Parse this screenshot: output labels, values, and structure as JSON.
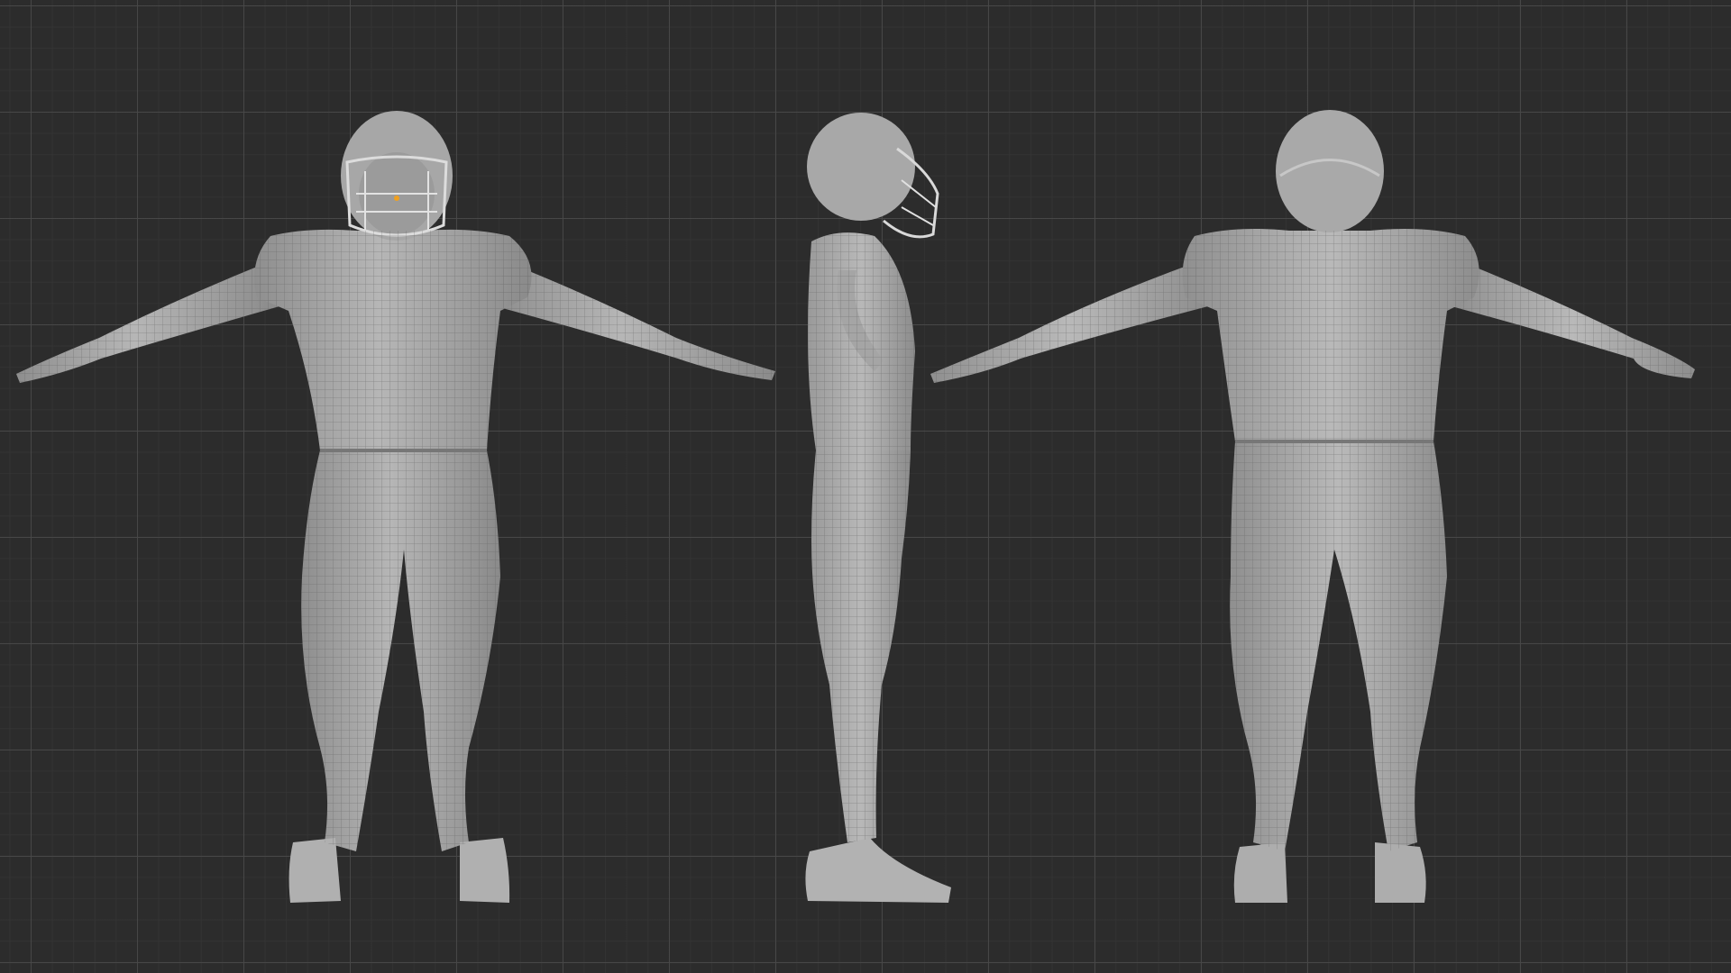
{
  "viewport": {
    "grid_color": "#484848",
    "background_color": "#2c2c2c"
  },
  "model": {
    "subject": "american-football-player",
    "material_color": "#a9a9a9",
    "wire_color": "#5a5a5a",
    "pose": "t-pose",
    "views": [
      {
        "id": "front",
        "icon": "mesh-front-view-icon"
      },
      {
        "id": "side",
        "icon": "mesh-side-view-icon"
      },
      {
        "id": "back",
        "icon": "mesh-back-view-icon"
      }
    ],
    "origin_marker_color": "#f0a020"
  }
}
